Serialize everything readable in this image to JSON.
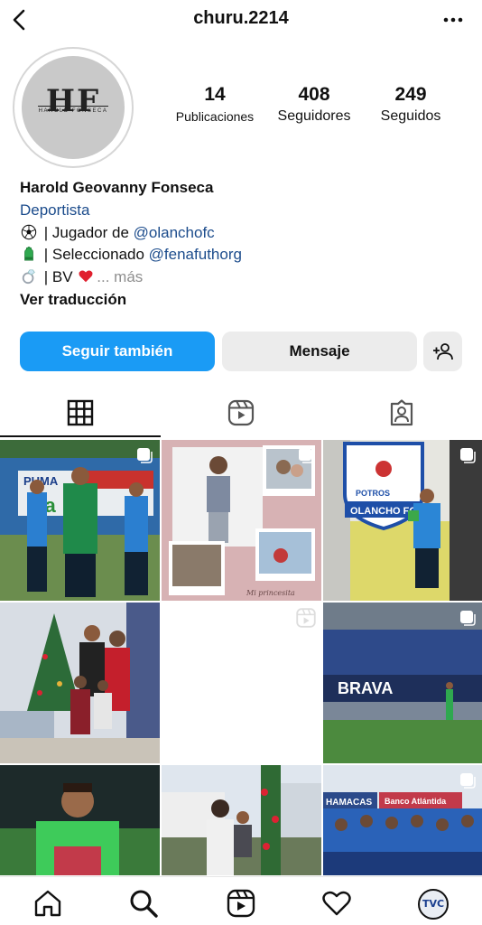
{
  "header": {
    "username": "churu.2214",
    "back_icon": "chevron-left-icon",
    "more_icon": "more-horizontal-icon"
  },
  "avatar": {
    "logo_text": "HF",
    "logo_subtext": "HAROLD FONSECA"
  },
  "stats": {
    "posts": {
      "count": "14",
      "label": "Publicaciones"
    },
    "followers": {
      "count": "408",
      "label": "Seguidores"
    },
    "following": {
      "count": "249",
      "label": "Seguidos"
    }
  },
  "bio": {
    "name": "Harold Geovanny Fonseca",
    "category": "Deportista",
    "line1_text": " | Jugador de ",
    "line1_link": "@olanchofc",
    "line2_text": " | Seleccionado ",
    "line2_link": "@fenafuthorg",
    "line3_text": " | BV ",
    "line3_more": "... más",
    "translate": "Ver traducción"
  },
  "actions": {
    "follow_label": "Seguir también",
    "message_label": "Mensaje",
    "add_icon": "add-person-icon"
  },
  "tabs": [
    {
      "name": "grid",
      "icon": "grid-icon",
      "active": true
    },
    {
      "name": "reels",
      "icon": "reels-icon",
      "active": false
    },
    {
      "name": "tagged",
      "icon": "tagged-icon",
      "active": false
    }
  ],
  "posts": [
    {
      "type": "photo",
      "banner": "PUMA",
      "multi": true
    },
    {
      "type": "photo",
      "caption": "Mi princesita",
      "multi": true
    },
    {
      "type": "photo",
      "banner": "POTROS",
      "banner2": "OLANCHO FC",
      "multi": true
    },
    {
      "type": "photo",
      "multi": false
    },
    {
      "type": "reel",
      "multi": false
    },
    {
      "type": "photo",
      "banner": "BRAVA",
      "multi": true
    },
    {
      "type": "photo",
      "multi": false
    },
    {
      "type": "photo",
      "multi": false
    },
    {
      "type": "photo",
      "banner": "HAMACAS",
      "banner2": "Banco Atlántida",
      "multi": true
    }
  ],
  "bottom_nav": {
    "home_icon": "home-icon",
    "search_icon": "search-icon",
    "reels_icon": "reels-icon",
    "activity_icon": "heart-icon",
    "profile_label": "TVC"
  },
  "colors": {
    "accent": "#1a9bf5",
    "link": "#1c4c8c",
    "muted": "#8e8e8e"
  }
}
